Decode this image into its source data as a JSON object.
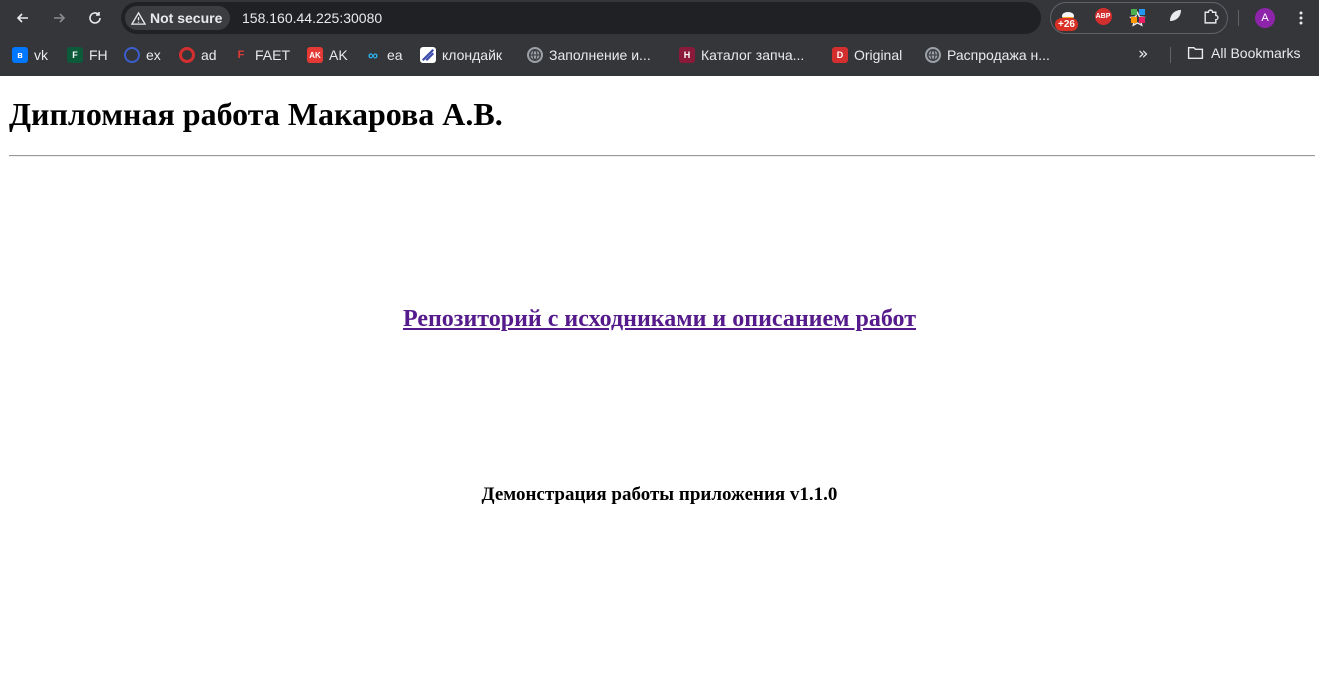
{
  "browser": {
    "security_label": "Not secure",
    "url": "158.160.44.225:30080",
    "extension_badge": "+26",
    "abp_label": "ABP",
    "profile_initial": "A",
    "bookmarks": [
      {
        "label": "vk",
        "favicon_text": "",
        "color": "#0077ff"
      },
      {
        "label": "FH",
        "favicon_text": "F",
        "color": "#0b5a3a"
      },
      {
        "label": "ex",
        "favicon_text": "",
        "color": "#3a5fcd"
      },
      {
        "label": "ad",
        "favicon_text": "",
        "color": "#d32f2f"
      },
      {
        "label": "FAET",
        "favicon_text": "F",
        "color": "#d32f2f"
      },
      {
        "label": "AK",
        "favicon_text": "AK",
        "color": "#e53935"
      },
      {
        "label": "ea",
        "favicon_text": "",
        "color": "#29b6f6"
      },
      {
        "label": "клондайк",
        "favicon_text": "",
        "color": "#3949ab"
      },
      {
        "label": "Заполнение и...",
        "favicon_text": "",
        "color": "#9aa0a6"
      },
      {
        "label": "Каталог запча...",
        "favicon_text": "",
        "color": "#8b1a3a"
      },
      {
        "label": "Original",
        "favicon_text": "D",
        "color": "#d32f2f"
      },
      {
        "label": "Распродажа н...",
        "favicon_text": "",
        "color": "#9aa0a6"
      }
    ],
    "all_bookmarks_label": "All Bookmarks",
    "overflow_label": "»"
  },
  "page": {
    "title": "Дипломная работа Макарова А.В.",
    "repo_link": "Репозиторий с исходниками и описанием работ",
    "demo_text": "Демонстрация работы приложения v1.1.0"
  }
}
